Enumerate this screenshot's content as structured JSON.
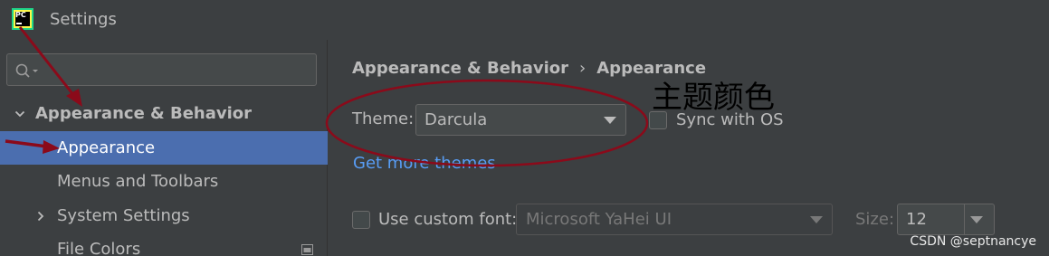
{
  "window": {
    "title": "Settings",
    "logo_text": "PC"
  },
  "sidebar": {
    "search": {
      "placeholder": ""
    },
    "items": [
      {
        "label": "Appearance & Behavior",
        "expanded": true
      },
      {
        "label": "Appearance",
        "selected": true
      },
      {
        "label": "Menus and Toolbars"
      },
      {
        "label": "System Settings",
        "expanded": false
      },
      {
        "label": "File Colors"
      }
    ]
  },
  "main": {
    "breadcrumb": {
      "parent": "Appearance & Behavior",
      "separator": "›",
      "current": "Appearance"
    },
    "theme": {
      "label": "Theme:",
      "value": "Darcula"
    },
    "sync_os": {
      "label": "Sync with OS",
      "checked": false
    },
    "get_more_link": "Get more themes",
    "custom_font": {
      "label": "Use custom font:",
      "checked": false,
      "font_value": "Microsoft YaHei UI",
      "size_label": "Size:",
      "size_value": "12"
    }
  },
  "annotation": {
    "text": "主题颜色",
    "color": "#000000",
    "marker_color": "#8b0a1a"
  },
  "watermark": "CSDN @septnancye",
  "colors": {
    "background": "#3c3f41",
    "selection": "#4b6eaf",
    "link": "#589df6",
    "text": "#bbbbbb"
  }
}
